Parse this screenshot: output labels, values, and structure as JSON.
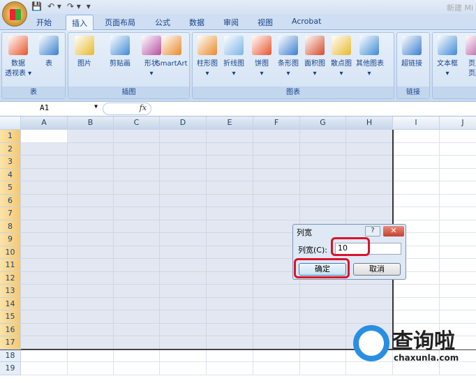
{
  "window": {
    "title": "新建 Mi",
    "qat": [
      "💾",
      "↶ ▾",
      "↷ ▾",
      "▾"
    ]
  },
  "tabs": [
    "开始",
    "插入",
    "页面布局",
    "公式",
    "数据",
    "审阅",
    "视图",
    "Acrobat"
  ],
  "active_tab": "插入",
  "ribbon": {
    "groups": [
      {
        "label": "表",
        "items": [
          "数据\n透视表 ▾",
          "表"
        ]
      },
      {
        "label": "插图",
        "items": [
          "图片",
          "剪贴画",
          "形状\n▾",
          "SmartArt"
        ]
      },
      {
        "label": "图表",
        "items": [
          "柱形图\n▾",
          "折线图\n▾",
          "饼图\n▾",
          "条形图\n▾",
          "面积图\n▾",
          "散点图\n▾",
          "其他图表\n▾"
        ]
      },
      {
        "label": "链接",
        "items": [
          "超链接"
        ]
      },
      {
        "label": "",
        "items": [
          "文本框\n▾",
          "页眉\n页脚"
        ]
      }
    ]
  },
  "formula_bar": {
    "name_box": "A1",
    "fx": "fx",
    "value": ""
  },
  "grid": {
    "columns": [
      "A",
      "B",
      "C",
      "D",
      "E",
      "F",
      "G",
      "H",
      "I",
      "J"
    ],
    "rows": [
      "1",
      "2",
      "3",
      "4",
      "5",
      "6",
      "7",
      "8",
      "9",
      "10",
      "11",
      "12",
      "13",
      "14",
      "15",
      "16",
      "17",
      "18",
      "19"
    ]
  },
  "dialog": {
    "title": "列宽",
    "help": "?",
    "close": "✕",
    "label": "列宽(C):",
    "value": "10",
    "ok": "确定",
    "cancel": "取消"
  },
  "watermark": {
    "text": "查询啦",
    "url": "chaxunla.com"
  },
  "colors": {
    "accent": "#15428b",
    "highlight": "#d8142b"
  }
}
